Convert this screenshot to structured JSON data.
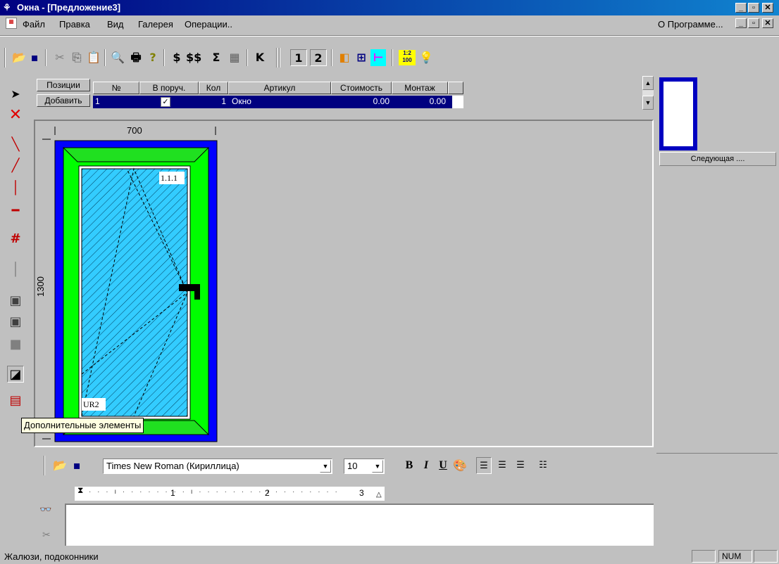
{
  "window": {
    "title": "Окна - [Предложение3]",
    "controls": [
      "_",
      "🗗",
      "✕"
    ]
  },
  "menu": {
    "items": [
      "Файл",
      "Правка",
      "Вид",
      "Галерея",
      "Операции.."
    ],
    "about": "О Программе..."
  },
  "toolbar": {
    "dollar": "$",
    "dollars": "$$",
    "sigma": "Σ",
    "k": "K",
    "one": "1",
    "two": "2",
    "scale_top": "1:2",
    "scale_bottom": "100"
  },
  "positions": {
    "label": "Позиции",
    "add_button": "Добавить",
    "columns": [
      "№",
      "В поруч.",
      "Кол",
      "Артикул",
      "Стоимость",
      "Монтаж"
    ],
    "row": {
      "num": "1",
      "checked": "✓",
      "qty": "1",
      "article": "Окно",
      "cost": "0.00",
      "mount": "0.00"
    }
  },
  "drawing": {
    "width_dim": "700",
    "height_dim": "1300",
    "sash_label": "1.1.1",
    "corner_label": "UR2"
  },
  "right_panel": {
    "next_button": "Следующая ...."
  },
  "tooltip": "Дополнительные элементы",
  "format": {
    "font": "Times New Roman (Кириллица)",
    "size": "10",
    "bold": "B",
    "italic": "I",
    "underline": "U"
  },
  "ruler": {
    "marks": [
      "1",
      "2",
      "3"
    ]
  },
  "status": {
    "text": "Жалюзи, подоконники",
    "num": "NUM"
  },
  "colors": {
    "titlebar": "#000080",
    "frame": "#0000ff",
    "sash": "#00ff00",
    "glass": "#33ccff",
    "selection": "#000080"
  }
}
